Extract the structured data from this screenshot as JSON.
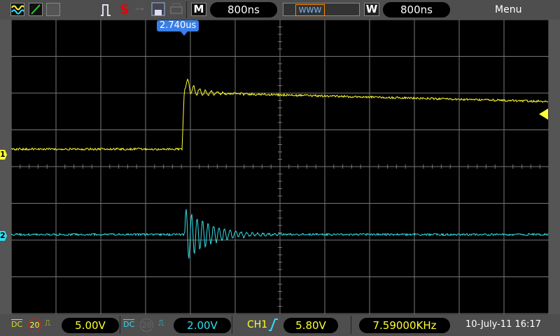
{
  "top": {
    "mode_icon": "M",
    "timebase": "800ns",
    "window_icon": "W",
    "window_timebase": "800ns",
    "menu": "Menu",
    "trigger_position": "2.740us",
    "status": "S"
  },
  "channels": [
    {
      "id": "1",
      "coupling": "DC",
      "bw_limit": "20",
      "scale": "5.00V",
      "color": "#ffff33"
    },
    {
      "id": "2",
      "coupling": "DC",
      "bw_limit": "20",
      "scale": "2.00V",
      "color": "#33e0e8"
    }
  ],
  "trigger": {
    "source": "CH1",
    "slope": "rising",
    "level": "5.80V"
  },
  "frequency": "7.59000KHz",
  "datetime": "10-July-11 16:17"
}
